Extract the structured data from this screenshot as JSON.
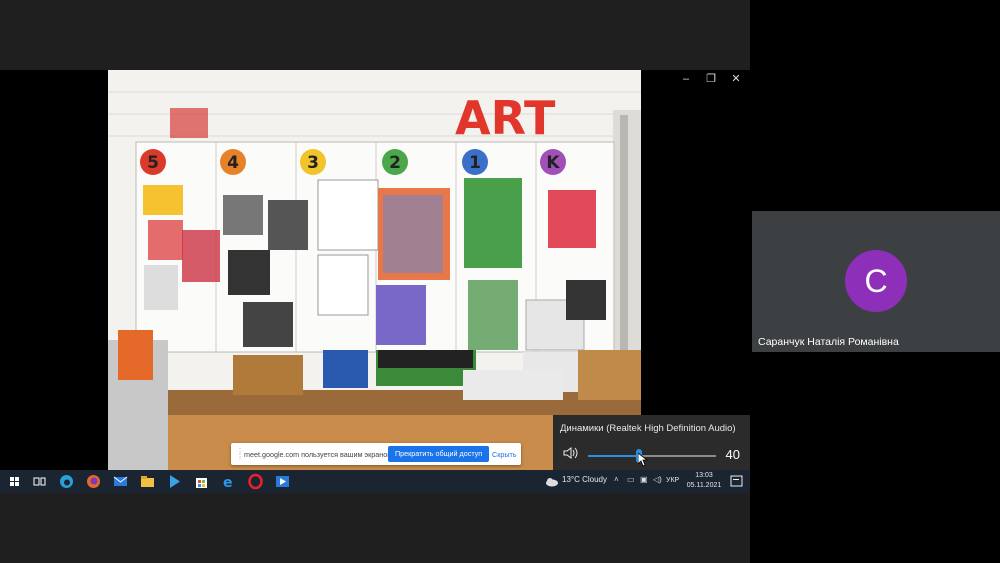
{
  "photo": {
    "sign_text": "ART"
  },
  "volume": {
    "device_label": "Динамики (Realtek High Definition Audio)",
    "level": 40,
    "level_fraction": 0.4
  },
  "share_bar": {
    "message": "meet.google.com пользуется вашим экраном.",
    "stop_label": "Прекратить общий доступ",
    "hide_label": "Скрыть"
  },
  "taskbar": {
    "weather": "13°C  Cloudy",
    "language": "УКР",
    "time": "13:03",
    "date": "05.11.2021"
  },
  "participant": {
    "initial": "С",
    "name": "Саранчук Наталія Романівна",
    "avatar_color": "#8d2fb8"
  },
  "colors": {
    "accent": "#1a73e8",
    "slider": "#2a8fe0"
  }
}
